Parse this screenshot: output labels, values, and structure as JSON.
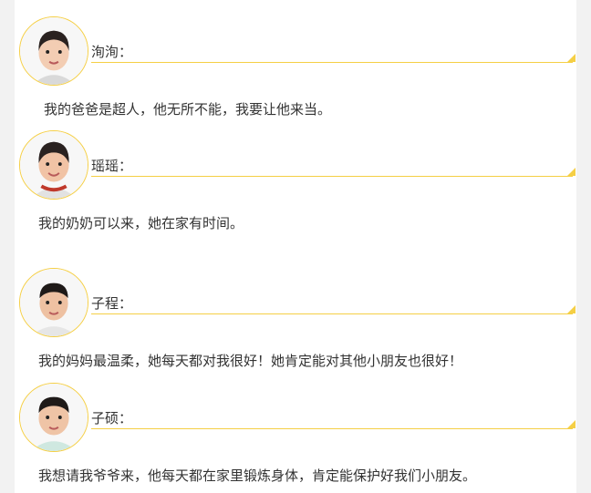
{
  "entries": [
    {
      "name": "洵洵：",
      "message": "我的爸爸是超人，他无所不能，我要让他来当。"
    },
    {
      "name": "瑶瑶：",
      "message": "我的奶奶可以来，她在家有时间。"
    },
    {
      "name": "子程：",
      "message": "我的妈妈最温柔，她每天都对我很好！她肯定能对其他小朋友也很好！"
    },
    {
      "name": "子硕：",
      "message": "我想请我爷爷来，他每天都在家里锻炼身体，肯定能保护好我们小朋友。"
    }
  ],
  "colors": {
    "accent": "#f5cf45",
    "text": "#333333",
    "background": "#ffffff"
  }
}
